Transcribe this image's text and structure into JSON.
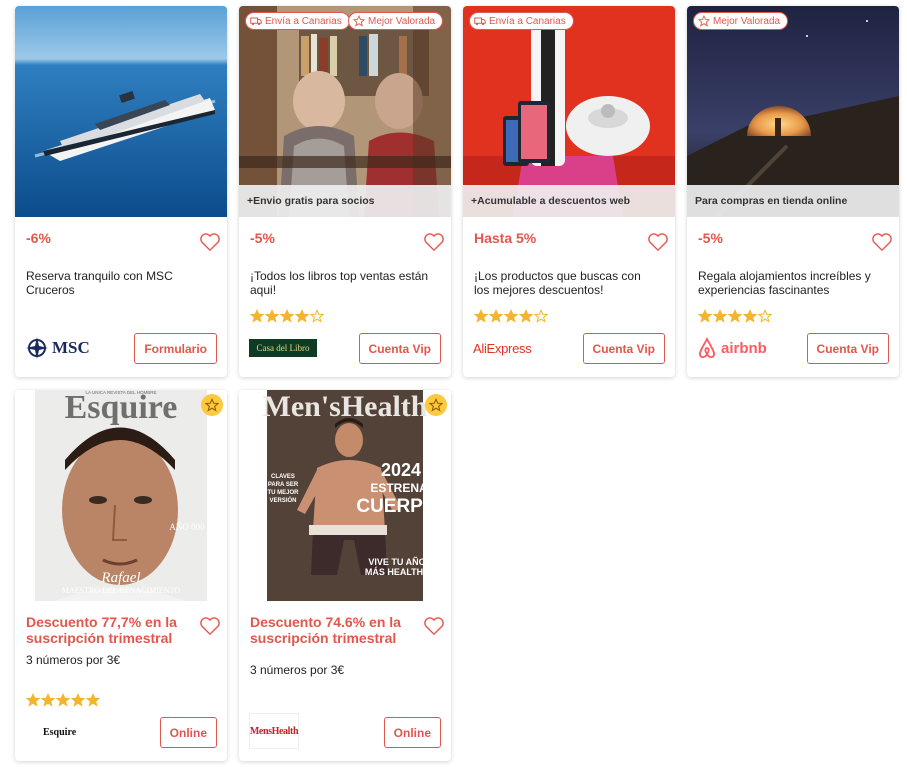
{
  "colors": {
    "accent": "#e2574c",
    "star": "#f3b531"
  },
  "cards": [
    {
      "discount": "-6%",
      "description": "Reserva tranquilo con MSC Cruceros",
      "button": "Formulario",
      "logo_text": "MSC",
      "rating": 0
    },
    {
      "badges": [
        "Envía a Canarias",
        "Mejor Valorada"
      ],
      "strip": "+Envio gratis para socios",
      "discount": "-5%",
      "description": "¡Todos los libros top ventas están aqui!",
      "button": "Cuenta Vip",
      "logo_text": "Casa del Libro",
      "rating": 4
    },
    {
      "badges": [
        "Envía a Canarias"
      ],
      "strip": "+Acumulable a descuentos web",
      "discount": "Hasta 5%",
      "description": "¡Los productos que buscas con los mejores descuentos!",
      "button": "Cuenta Vip",
      "logo_text": "AliExpress",
      "rating": 4
    },
    {
      "badges": [
        "Mejor Valorada"
      ],
      "strip": "Para compras en tienda online",
      "discount": "-5%",
      "description": "Regala alojamientos increíbles y experiencias fascinantes",
      "button": "Cuenta Vip",
      "logo_text": "airbnb",
      "rating": 4
    },
    {
      "discount": "Descuento 77,7% en la suscripción trimestral",
      "description": "3 números por 3€",
      "button": "Online",
      "logo_text": "Esquire",
      "rating": 5,
      "cover": {
        "masthead": "Esquire",
        "tagline": "LA UNICA REVISTA DEL HOMBRE",
        "name": "Rafael",
        "subtitle": "MAESTRO DEL RENACIMIENTO",
        "side": "AÑO 000"
      }
    },
    {
      "discount": "Descuento 74.6% en la suscripción trimestral",
      "description": "3 números por 3€",
      "button": "Online",
      "logo_text": "MensHealth",
      "rating": 0,
      "cover": {
        "masthead": "Men'sHealth",
        "year": "2024",
        "headline1": "ESTRENA",
        "headline2": "CUERPO",
        "left_lines": [
          "CLAVES",
          "PARA SER",
          "TU MEJOR",
          "VERSIÓN"
        ],
        "bottom1": "VIVE TU AÑO",
        "bottom2": "MÁS HEALTHY"
      }
    }
  ]
}
